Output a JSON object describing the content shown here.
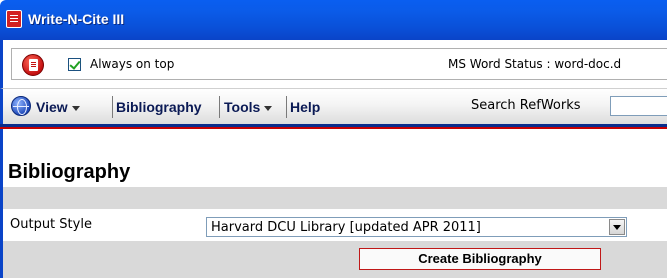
{
  "window": {
    "title": "Write-N-Cite III",
    "title_icon": "app-doc-icon"
  },
  "options_bar": {
    "pdf_icon": "pdf-icon",
    "always_on_top_label": "Always on top",
    "always_on_top_checked": true,
    "word_status": "MS Word Status : word-doc.d"
  },
  "menubar": {
    "globe_icon": "globe-icon",
    "items": [
      {
        "label": "View",
        "has_dropdown": true
      },
      {
        "label": "Bibliography",
        "has_dropdown": false
      },
      {
        "label": "Tools",
        "has_dropdown": true
      },
      {
        "label": "Help",
        "has_dropdown": false
      }
    ],
    "search_label": "Search RefWorks",
    "search_value": ""
  },
  "main": {
    "title": "Bibliography",
    "output_style_label": "Output Style",
    "output_style_value": "Harvard DCU Library [updated APR 2011]",
    "create_button_label": "Create Bibliography"
  },
  "colors": {
    "title_bar": "#0a50d8",
    "accent_red": "#c40000",
    "band_gray": "#d9d9d9"
  }
}
